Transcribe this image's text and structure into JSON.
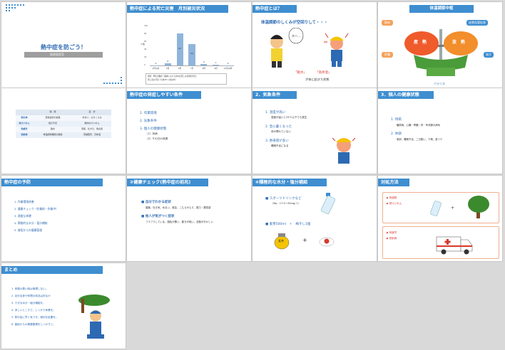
{
  "slides": [
    {
      "title": "熱中症を防ごう！",
      "subtitle": "健康管理室"
    },
    {
      "title": "熱中症による死亡災害　月別被災状況",
      "note1": "資料：厚生労働省「職場における熱中症死亡災害発生状況」",
      "note2": "死亡者の月別（平成30〜令和4年）"
    },
    {
      "title": "熱中症とは？",
      "subtitle": "体温調節のしくみが空回りして・・・",
      "word1": "「脱水」",
      "word2": "「高体温」",
      "caption": "が体に起きた状態",
      "speech": "ホー…"
    },
    {
      "title": "体温調節中枢",
      "label_muscle": "筋肉",
      "label_skin": "皮膚血管拡張",
      "label_sweat": "発汗",
      "label_liver": "肝臓",
      "produce": "産　熱",
      "release": "放　熱",
      "balance": "バランス"
    },
    {
      "table_headers": [
        "",
        "病　態",
        "症　状"
      ],
      "table_rows": [
        [
          "熱失神",
          "皮膚血管の拡張",
          "めまい、立ちくらみ"
        ],
        [
          "熱けいれん",
          "塩分不足",
          "筋肉のけいれん"
        ],
        [
          "熱疲労",
          "脱水",
          "頭痛、吐き気、倦怠感"
        ],
        [
          "熱射病",
          "体温調節機能の破綻",
          "意識障害、高体温"
        ]
      ]
    },
    {
      "title": "熱中症の発症しやすい条件",
      "items": [
        "1. 作業環境",
        "2. 気象条件",
        "3. 個人の健康状態"
      ],
      "sub1": "（1）持病",
      "sub2": "（2）その日の体調"
    },
    {
      "title": "2．気象条件",
      "h1": "1. 湿度が高い",
      "d1": "湿度が高いと25℃以下でも発生",
      "h2": "2. 急に暑くなった",
      "d2": "体が慣れていない",
      "h3": "3. 熱帯夜が多い",
      "d3": "睡眠不足になる"
    },
    {
      "title": "3．個人の健康状態",
      "h1": "1. 持病",
      "d1": "糖尿病、心臓・腎臓・肝・甲状腺の病気",
      "h2": "2. 体調",
      "d2": "風邪、睡眠不足、二日酔い、下痢、夏バテ"
    },
    {
      "title": "熱中症の予防",
      "items": [
        "1. 作業環境改善",
        "2. 健康チェック（作業前・作業中）",
        "3. 適度な休憩",
        "4. 積極的な水分・塩分補給",
        "5. 普段からの健康管理"
      ]
    },
    {
      "title": "②健康チェック(熱中症の前兆)",
      "h1": "■ 自分でわかる症状",
      "d1": "頭痛、吐き気、めまい、倦怠、こむらがえり、脱力・悪寒感",
      "h2": "■ 他人が気がつく症状",
      "d2": "フラフラしている、顔色が悪い、動きが鈍い、言動がおかしい"
    },
    {
      "title": "④積極的な水分・塩分補給",
      "h1": "■ スポーツドリンクなど",
      "d1": "（Na：17.5〜35mg/ｌ）",
      "h2": "■ 麦茶500ml　＋　梅干し1個",
      "tea": "麦茶"
    },
    {
      "title": "対処方法",
      "b1a": "▶ 熱虚脱",
      "b1b": "▶ 熱けいれん",
      "b2a": "▶ 熱疲労",
      "b2b": "▶ 熱射病"
    },
    {
      "title": "まとめ",
      "items": [
        "1. 体調の悪い時は無理しない。",
        "2. 自分自身や仲間の前兆は判るか",
        "3. 十分な水分・塩分補給を。",
        "4. 涼しいところで、しっかり休養を。",
        "5. 熱中症に早く気づき、適切な処置を。",
        "6. 普段からの健康管理をしっかりと。"
      ]
    }
  ],
  "chart_data": {
    "type": "bar",
    "categories": [
      "4月以前",
      "5月",
      "6月",
      "7月",
      "8月",
      "9月",
      "10月以降"
    ],
    "values": [
      0,
      6,
      81,
      54,
      4,
      1,
      0
    ],
    "ylim": [
      0,
      100
    ],
    "yticks": [
      "100",
      "80",
      "60",
      "40",
      "20",
      "0"
    ],
    "ylabel": "人数",
    "bar_color": "#8fb5dc"
  },
  "colors": {
    "accent": "#3e8ed0",
    "title_blue": "#2d6ab3",
    "orange": "#f5a15a",
    "red": "#d8392b"
  }
}
